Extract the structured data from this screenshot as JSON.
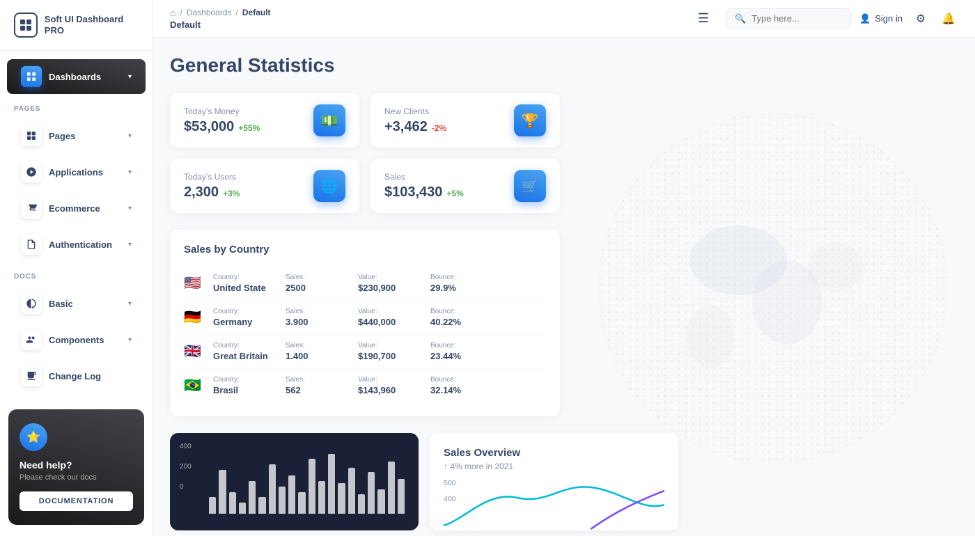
{
  "app": {
    "name": "Soft UI Dashboard PRO"
  },
  "topbar": {
    "breadcrumb": {
      "home": "🏠",
      "sep1": "/",
      "dashboards": "Dashboards",
      "sep2": "/",
      "current": "Default"
    },
    "page_title": "Default",
    "search_placeholder": "Type here...",
    "signin_label": "Sign in"
  },
  "sidebar": {
    "section_pages": "PAGES",
    "section_docs": "DOCS",
    "items_pages": [
      {
        "id": "dashboards",
        "label": "Dashboards",
        "active": true
      },
      {
        "id": "pages",
        "label": "Pages",
        "active": false
      },
      {
        "id": "applications",
        "label": "Applications",
        "active": false
      },
      {
        "id": "ecommerce",
        "label": "Ecommerce",
        "active": false
      },
      {
        "id": "authentication",
        "label": "Authentication",
        "active": false
      }
    ],
    "items_docs": [
      {
        "id": "basic",
        "label": "Basic",
        "active": false
      },
      {
        "id": "components",
        "label": "Components",
        "active": false
      },
      {
        "id": "changelog",
        "label": "Change Log",
        "active": false
      }
    ]
  },
  "help_card": {
    "title": "Need help?",
    "subtitle": "Please check our docs",
    "button_label": "DOCUMENTATION"
  },
  "main": {
    "heading": "General Statistics",
    "stats": [
      {
        "label": "Today's Money",
        "value": "$53,000",
        "change": "+55%",
        "change_type": "pos",
        "icon": "💵"
      },
      {
        "label": "New Clients",
        "value": "+3,462",
        "change": "-2%",
        "change_type": "neg",
        "icon": "🏆"
      },
      {
        "label": "Today's Users",
        "value": "2,300",
        "change": "+3%",
        "change_type": "pos",
        "icon": "🌐"
      },
      {
        "label": "Sales",
        "value": "$103,430",
        "change": "+5%",
        "change_type": "pos",
        "icon": "🛒"
      }
    ],
    "sales_by_country": {
      "title": "Sales by Country",
      "col_country": "Country:",
      "col_sales": "Sales:",
      "col_value": "Value:",
      "col_bounce": "Bounce:",
      "rows": [
        {
          "flag": "🇺🇸",
          "country": "United State",
          "sales": "2500",
          "value": "$230,900",
          "bounce": "29.9%"
        },
        {
          "flag": "🇩🇪",
          "country": "Germany",
          "sales": "3.900",
          "value": "$440,000",
          "bounce": "40.22%"
        },
        {
          "flag": "🇬🇧",
          "country": "Great Britain",
          "sales": "1.400",
          "value": "$190,700",
          "bounce": "23.44%"
        },
        {
          "flag": "🇧🇷",
          "country": "Brasil",
          "sales": "562",
          "value": "$143,960",
          "bounce": "32.14%"
        }
      ]
    },
    "chart": {
      "y_labels": [
        "400",
        "200",
        "0"
      ],
      "bars": [
        15,
        40,
        20,
        10,
        30,
        15,
        45,
        25,
        35,
        20,
        50,
        30,
        55,
        28,
        42,
        18,
        38,
        22,
        48,
        32
      ]
    },
    "sales_overview": {
      "title": "Sales Overview",
      "change": "↑ 4% more in 2021",
      "y_labels": [
        "500",
        "400"
      ]
    }
  }
}
